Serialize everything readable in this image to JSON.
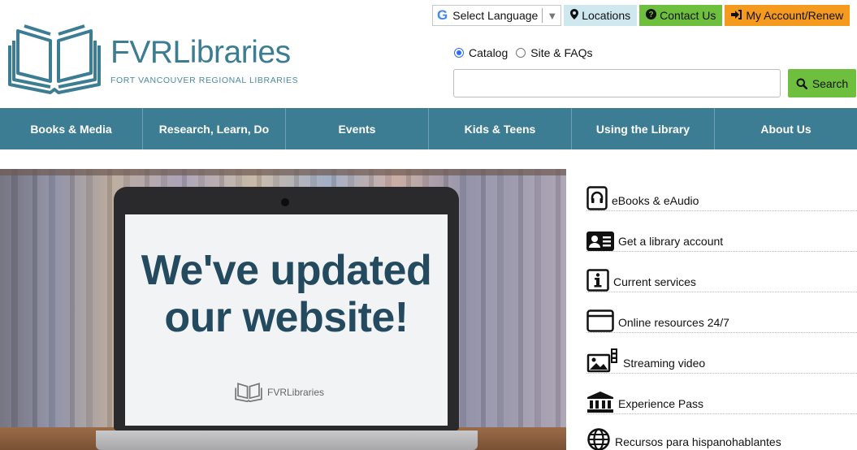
{
  "utility": {
    "language_label": "Select Language",
    "locations_label": "Locations",
    "contact_label": "Contact Us",
    "account_label": "My Account/Renew"
  },
  "brand": {
    "name": "FVRLibraries",
    "subtitle": "FORT VANCOUVER REGIONAL LIBRARIES",
    "primary_color": "#3d7d94"
  },
  "search": {
    "scopes": [
      {
        "label": "Catalog",
        "selected": true
      },
      {
        "label": "Site & FAQs",
        "selected": false
      }
    ],
    "query": "",
    "button_label": "Search",
    "button_color": "#6fbf3f"
  },
  "nav": {
    "items": [
      {
        "label": "Books & Media"
      },
      {
        "label": "Research, Learn, Do"
      },
      {
        "label": "Events"
      },
      {
        "label": "Kids & Teens"
      },
      {
        "label": "Using the Library"
      },
      {
        "label": "About Us"
      }
    ]
  },
  "hero": {
    "headline_line1": "We've updated",
    "headline_line2": "our website!",
    "screen_logo": "FVRLibraries"
  },
  "quick_links": [
    {
      "label": "eBooks & eAudio",
      "icon": "tablet-headphones-icon"
    },
    {
      "label": "Get a library account",
      "icon": "id-card-icon"
    },
    {
      "label": "Current services",
      "icon": "info-icon"
    },
    {
      "label": "Online resources 24/7",
      "icon": "browser-window-icon"
    },
    {
      "label": "Streaming video",
      "icon": "film-image-icon"
    },
    {
      "label": "Experience Pass",
      "icon": "museum-icon"
    },
    {
      "label": "Recursos para hispanohablantes",
      "icon": "globe-icon"
    }
  ]
}
